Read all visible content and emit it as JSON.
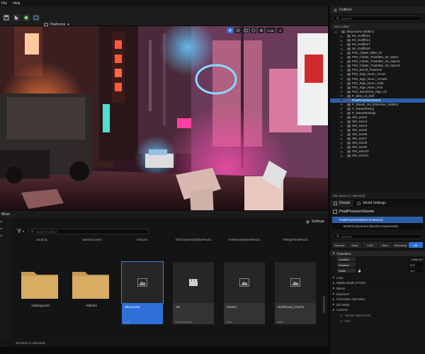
{
  "menu": {
    "items": [
      "File",
      "Help"
    ]
  },
  "toolbar": {
    "platforms_label": "Platforms",
    "platforms_chevron": "▾"
  },
  "viewport": {
    "toolbar_values": [
      "0.25",
      "4"
    ]
  },
  "outliner": {
    "tab_label": "Outliner",
    "search_placeholder": "Search",
    "column_header": "Item Label",
    "rows": [
      {
        "label": "alleycourse (Editor)",
        "indent": 0,
        "selected": false
      },
      {
        "label": "MI_Graffiti12",
        "indent": 1,
        "selected": false
      },
      {
        "label": "MI_Graffiti13",
        "indent": 1,
        "selected": false
      },
      {
        "label": "MI_Graffiti17",
        "indent": 1,
        "selected": false
      },
      {
        "label": "MI_Graffiti20",
        "indent": 1,
        "selected": false
      },
      {
        "label": "P02_Clutter_Bike_01",
        "indent": 1,
        "selected": false
      },
      {
        "label": "P02_Clutter_TrashBin_02_Open",
        "indent": 1,
        "selected": false
      },
      {
        "label": "P02_Clutter_TrashBin_02_Open2",
        "indent": 1,
        "selected": false
      },
      {
        "label": "P02_Clutter_TrashBin_02_Open3",
        "indent": 1,
        "selected": false
      },
      {
        "label": "P02_Decal_Posters2",
        "indent": 1,
        "selected": false
      },
      {
        "label": "P02_Sign_Neon_Arrow",
        "indent": 1,
        "selected": false
      },
      {
        "label": "P02_Sign_Neon_Arrow3",
        "indent": 1,
        "selected": false
      },
      {
        "label": "P02_Sign_Neon_Girls",
        "indent": 1,
        "selected": false
      },
      {
        "label": "P02_Sign_Neon_Pub",
        "indent": 1,
        "selected": false
      },
      {
        "label": "P02_Storefront_Sign_01",
        "indent": 1,
        "selected": false
      },
      {
        "label": "P_Mist_Lit_Still",
        "indent": 1,
        "selected": false
      },
      {
        "label": "PostProcessVolume",
        "indent": 1,
        "selected": true
      },
      {
        "label": "P_Steam_Jet_Emissive_Subtle2",
        "indent": 1,
        "selected": false
      },
      {
        "label": "P_SteamRising",
        "indent": 1,
        "selected": false
      },
      {
        "label": "P_SteamRising2",
        "indent": 1,
        "selected": false
      },
      {
        "label": "SM_4x2x2",
        "indent": 1,
        "selected": false
      },
      {
        "label": "SM_4x2x3",
        "indent": 1,
        "selected": false
      },
      {
        "label": "SM_4x2x4",
        "indent": 1,
        "selected": false
      },
      {
        "label": "SM_4x2x5",
        "indent": 1,
        "selected": false
      },
      {
        "label": "SM_4x2x6",
        "indent": 1,
        "selected": false
      },
      {
        "label": "SM_4x2x7",
        "indent": 1,
        "selected": false
      },
      {
        "label": "SM_4x2x8",
        "indent": 1,
        "selected": false
      },
      {
        "label": "SM_4x2x9",
        "indent": 1,
        "selected": false
      },
      {
        "label": "SM_4x2x10",
        "indent": 1,
        "selected": false
      },
      {
        "label": "SM_4x2x11",
        "indent": 1,
        "selected": false
      }
    ],
    "status": "681 actors (1 selected)"
  },
  "details": {
    "tab_details": "Details",
    "tab_world": "World Settings",
    "actor_name": "PostProcessVolume",
    "components": [
      "PostProcessVolume (Instance)",
      "BrushComponent (BrushComponent0)"
    ],
    "search_placeholder": "Search",
    "filters": [
      "General",
      "Actor",
      "LOD",
      "Misc",
      "Streaming",
      "All"
    ],
    "transform": {
      "header": "Transform",
      "rows": [
        {
          "label": "Location",
          "mode": "Location",
          "value": "-1398.912"
        },
        {
          "label": "Rotation",
          "mode": "Rotation",
          "value": "0.0°"
        },
        {
          "label": "Scale",
          "mode": "Scale",
          "value": "1.0"
        }
      ]
    },
    "categories": [
      "Lens",
      "Mobile Depth of Field",
      "Bloom",
      "Exposure",
      "Chromatic Aberration",
      "Dirt Mask",
      "Camera"
    ],
    "camera_subrows": [
      "Shutter Speed (1/s)",
      "ISO"
    ]
  },
  "content_browser": {
    "tab_label": "Mixer",
    "settings_label": "Settings",
    "search_placeholder": "Search CabinA",
    "top_labels": [
      "SoulCity",
      "StarterContent",
      "textures",
      "TMChairsAndTablesPack1",
      "TMEntertainmentPack1",
      "TMHighTechPack1"
    ],
    "folders": [
      {
        "name": "Underground"
      },
      {
        "name": "Vehicles"
      }
    ],
    "tiles": [
      {
        "name": "alleycourse",
        "kind": "Level",
        "selected": true
      },
      {
        "name": "cat",
        "kind": "Level Sequence",
        "selected": false
      },
      {
        "name": "iceland",
        "kind": "Level",
        "selected": false
      },
      {
        "name": "Northwood_Church",
        "kind": "Level",
        "selected": false
      }
    ],
    "status": "45 items (1 selected)"
  },
  "colors": {
    "accent": "#2f6fd8",
    "selection": "#2b5faa",
    "panel": "#151515"
  }
}
